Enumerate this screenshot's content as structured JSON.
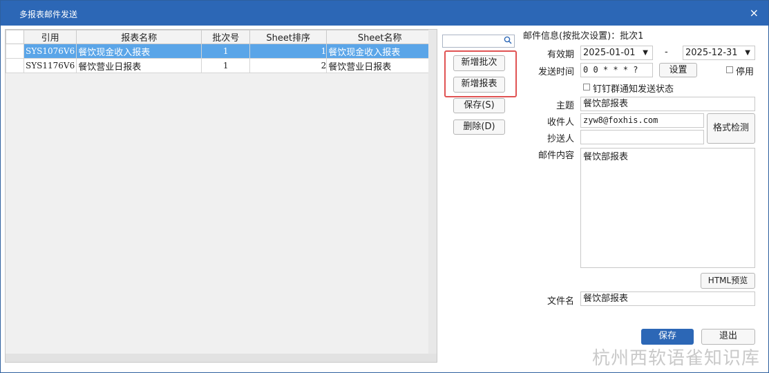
{
  "window": {
    "title": "多报表邮件发送",
    "close_glyph": "×"
  },
  "grid": {
    "columns": [
      "引用",
      "报表名称",
      "批次号",
      "Sheet排序",
      "Sheet名称"
    ],
    "rows": [
      {
        "ref": "SYS1076V6",
        "name": "餐饮现金收入报表",
        "batch": "1",
        "sort": "1",
        "sheet": "餐饮现金收入报表",
        "selected": true
      },
      {
        "ref": "SYS1176V6",
        "name": "餐饮营业日报表",
        "batch": "1",
        "sort": "2",
        "sheet": "餐饮营业日报表",
        "selected": false
      }
    ]
  },
  "search": {
    "placeholder": "",
    "icon": "search-icon"
  },
  "actions": {
    "add_batch": "新增批次",
    "add_report": "新增报表",
    "save": "保存(S)",
    "delete": "删除(D)"
  },
  "mail": {
    "section_title": "邮件信息(按批次设置)：批次1",
    "valid_label": "有效期",
    "valid_from": "2025-01-01",
    "valid_sep": "-",
    "valid_to": "2025-12-31",
    "send_time_label": "发送时间",
    "send_time_value": "0 0 * * * ?",
    "set_button": "设置",
    "disable_label": "停用",
    "dingtalk_label": "钉钉群通知发送状态",
    "subject_label": "主题",
    "subject_value": "餐饮部报表",
    "to_label": "收件人",
    "to_value": "zyw8@foxhis.com",
    "format_check_button": "格式检测",
    "cc_label": "抄送人",
    "cc_value": "",
    "body_label": "邮件内容",
    "body_value": "餐饮部报表",
    "html_preview_button": "HTML预览",
    "filename_label": "文件名",
    "filename_value": "餐饮部报表"
  },
  "footer": {
    "save": "保存",
    "exit": "退出"
  },
  "watermark": "杭州西软语雀知识库",
  "colors": {
    "titlebar": "#2c67b6",
    "selected_row": "#5aa5e8",
    "highlight_border": "#e05252"
  }
}
